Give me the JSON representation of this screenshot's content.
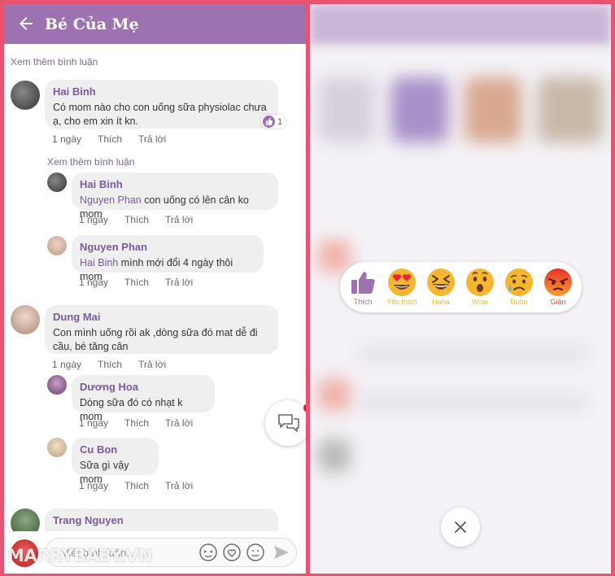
{
  "header": {
    "title": "Bé Của Mẹ"
  },
  "load_more": "Xem thêm bình luận",
  "actions": {
    "time": "1 ngày",
    "like": "Thích",
    "reply": "Trả lời"
  },
  "comments": [
    {
      "name": "Hai Binh",
      "text": "Có mom nào cho con uống sữa physiolac chưa ạ, cho em xin ít kn.",
      "like_count": "1"
    },
    {
      "name": "Hai Binh",
      "mention": "Nguyen Phan",
      "text": " con uống có lên cân ko mom"
    },
    {
      "name": "Nguyen Phan",
      "mention": "Hai Binh",
      "text": " mình mới đổi 4 ngày thôi mom"
    },
    {
      "name": "Dung Mai",
      "text": "Con mình uống rồi ak ,dòng sữa đó mat dễ đi cầu, bé tăng cân"
    },
    {
      "name": "Dương Hoa",
      "text": "Dòng sữa đó có nhạt k mom"
    },
    {
      "name": "Cu Bon",
      "text": "Sữa gì vậy mom"
    },
    {
      "name": "Trang Nguyen",
      "text": ""
    }
  ],
  "composer": {
    "placeholder": "Viết bình luận..."
  },
  "watermark": "MARRYBABY.VN",
  "reactions": [
    {
      "label": "Thích",
      "color": "#9c72b0",
      "icon": "thumbs-up-icon"
    },
    {
      "label": "Yêu thích",
      "color": "#f5b731",
      "icon": "heart-eyes-icon"
    },
    {
      "label": "Haha",
      "color": "#f5b731",
      "icon": "laughing-icon"
    },
    {
      "label": "Wow",
      "color": "#f5b731",
      "icon": "surprised-icon"
    },
    {
      "label": "Buồn",
      "color": "#f5b731",
      "icon": "sad-icon"
    },
    {
      "label": "Giận",
      "color": "#e8532a",
      "icon": "angry-icon"
    }
  ]
}
